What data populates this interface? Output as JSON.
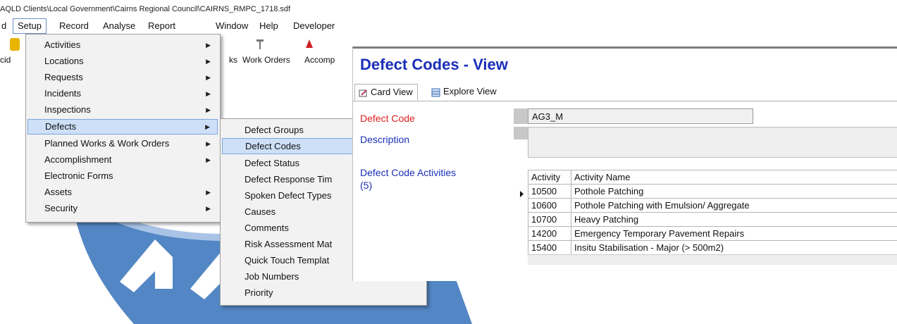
{
  "window": {
    "title_path": "AQLD Clients\\Local Government\\Cairns Regional Council\\CAIRNS_RMPC_1718.sdf"
  },
  "menubar": {
    "items": [
      "d",
      "Setup",
      "Record",
      "Analyse",
      "Report",
      "Window",
      "Help",
      "Developer"
    ]
  },
  "toolbar": {
    "labels": [
      "cid",
      "ks",
      "Work Orders",
      "Accomp"
    ]
  },
  "setup_menu": {
    "items": [
      {
        "label": "Activities",
        "submenu": true
      },
      {
        "label": "Locations",
        "submenu": true
      },
      {
        "label": "Requests",
        "submenu": true
      },
      {
        "label": "Incidents",
        "submenu": true
      },
      {
        "label": "Inspections",
        "submenu": true
      },
      {
        "label": "Defects",
        "submenu": true
      },
      {
        "label": "Planned Works & Work Orders",
        "submenu": true
      },
      {
        "label": "Accomplishment",
        "submenu": true
      },
      {
        "label": "Electronic Forms",
        "submenu": false
      },
      {
        "label": "Assets",
        "submenu": true
      },
      {
        "label": "Security",
        "submenu": true
      }
    ],
    "highlighted": "Defects"
  },
  "defects_menu": {
    "items": [
      "Defect Groups",
      "Defect Codes",
      "Defect Status",
      "Defect Response Tim",
      "Spoken Defect Types",
      "Causes",
      "Comments",
      "Risk Assessment Mat",
      "Quick Touch Templat",
      "Job Numbers",
      "Priority"
    ],
    "highlighted": "Defect Codes"
  },
  "defect_codes_view": {
    "title": "Defect Codes - View",
    "tabs": [
      "Card View",
      "Explore View"
    ],
    "active_tab": "Card View",
    "fields": {
      "defect_code_label": "Defect Code",
      "defect_code_value": "AG3_M",
      "description_label": "Description",
      "description_value": "",
      "activities_label_line1": "Defect Code Activities",
      "activities_label_line2": "(5)"
    },
    "activities_table": {
      "columns": [
        "Activity",
        "Activity Name"
      ],
      "rows": [
        {
          "activity": "10500",
          "name": "Pothole Patching",
          "current": true
        },
        {
          "activity": "10600",
          "name": "Pothole Patching with Emulsion/ Aggregate",
          "current": false
        },
        {
          "activity": "10700",
          "name": "Heavy Patching",
          "current": false
        },
        {
          "activity": "14200",
          "name": "Emergency Temporary  Pavement Repairs",
          "current": false
        },
        {
          "activity": "15400",
          "name": "Insitu Stabilisation - Major (> 500m2)",
          "current": false
        }
      ]
    }
  },
  "colors": {
    "title_blue": "#1a2fb8",
    "required_red": "#e02020",
    "menu_highlight": "#cde0f7",
    "swoosh_blue": "#4a7fc1"
  }
}
